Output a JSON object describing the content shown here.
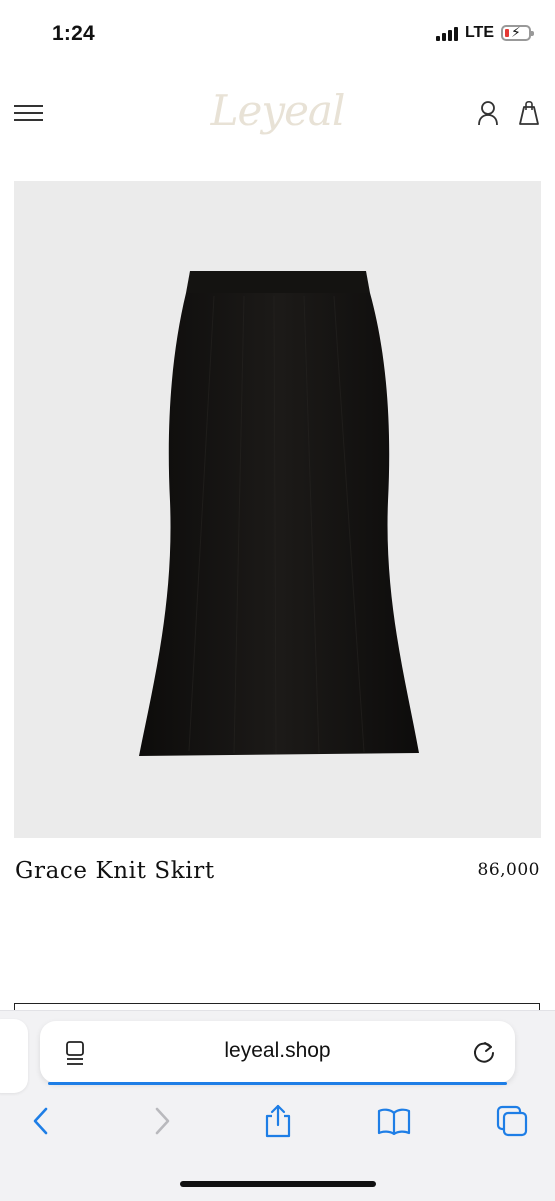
{
  "status_bar": {
    "time": "1:24",
    "network": "LTE",
    "battery_icon": "battery-low-charging-icon",
    "signal_icon": "signal-bars-icon"
  },
  "header": {
    "logo_text": "Leyeal",
    "logo_color": "#e8e2d6",
    "menu_icon": "hamburger-menu-icon",
    "account_icon": "user-icon",
    "cart_icon": "shopping-bag-icon"
  },
  "product": {
    "name": "Grace Knit Skirt",
    "price": "86,000",
    "image_description_icon": "black-knit-skirt-image"
  },
  "browser": {
    "url": "leyeal.shop",
    "accent_color": "#1e7ee6",
    "toolbar": {
      "back_icon": "chevron-left-icon",
      "forward_icon": "chevron-right-icon",
      "share_icon": "share-icon",
      "bookmarks_icon": "book-icon",
      "tabs_icon": "tabs-icon"
    }
  }
}
